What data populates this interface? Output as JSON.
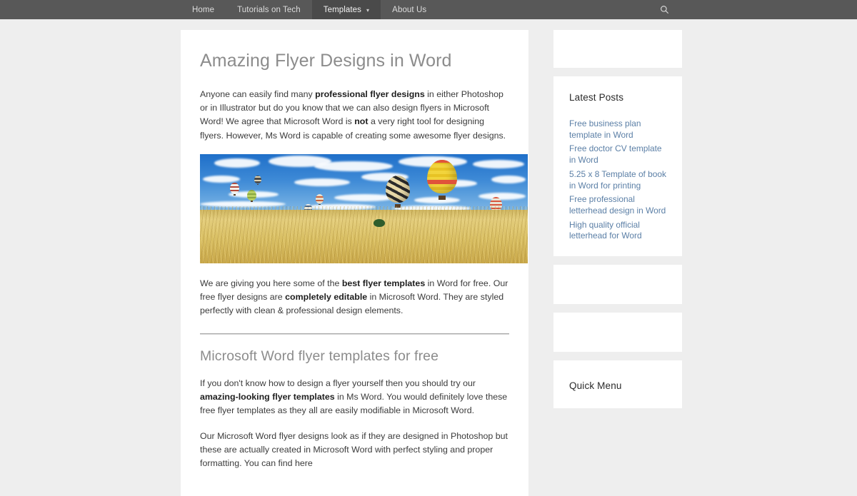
{
  "theme": {
    "nav_bg": "#585858",
    "nav_active_bg": "#4a4a4a",
    "page_bg": "#eeeeee",
    "card_bg": "#ffffff",
    "heading_color": "#8c8c8c",
    "body_text_color": "#3b3b3b",
    "link_color": "#5b7fa6",
    "rule_color": "#a8a8a8"
  },
  "nav": {
    "items": [
      {
        "label": "Home",
        "active": false,
        "has_caret": false
      },
      {
        "label": "Tutorials on Tech",
        "active": false,
        "has_caret": false
      },
      {
        "label": "Templates",
        "active": true,
        "has_caret": true
      },
      {
        "label": "About Us",
        "active": false,
        "has_caret": false
      }
    ],
    "caret_glyph": "▾",
    "search_icon": "search-icon"
  },
  "article": {
    "title": "Amazing Flyer Designs in Word",
    "para1": {
      "part1": "Anyone can easily find many ",
      "bold1": "professional flyer designs",
      "part2": " in either Photoshop or in Illustrator but do you know that we can also design flyers in Microsoft Word! We agree that Microsoft Word is ",
      "bold2": "not",
      "part3": " a very right tool for designing flyers. However, Ms Word is capable of creating some awesome flyer designs."
    },
    "hero_image": {
      "alt": "Hot air balloons flying over a golden wheat field under a blue sky with clouds",
      "name": "hot-air-balloons-wheat-field-photo"
    },
    "para2": {
      "part1": "We are giving you here some of the ",
      "bold1": "best flyer templates",
      "part2": " in Word for free. Our free flyer designs are ",
      "bold2": "completely editable",
      "part3": " in Microsoft Word. They are styled perfectly with clean & professional design elements."
    },
    "subtitle": "Microsoft Word flyer templates for free",
    "para3": {
      "part1": "If you don't know how to design a flyer yourself then you should try our ",
      "bold1": "amazing-looking flyer templates",
      "part2": " in Ms Word. You would definitely love these free flyer templates as they all are easily modifiable in Microsoft Word."
    },
    "para4": {
      "part1": "Our Microsoft Word flyer designs look as if they are designed in Photoshop but these are actually created in Microsoft Word with perfect styling and proper formatting. You can find here"
    }
  },
  "sidebar": {
    "latest_posts": {
      "title": "Latest Posts",
      "links": [
        "Free business plan template in Word",
        "Free doctor CV template in Word",
        "5.25 x 8 Template of book in Word for printing",
        "Free professional letterhead design in Word",
        "High quality official letterhead for Word"
      ]
    },
    "quick_menu": {
      "title": "Quick Menu"
    }
  }
}
